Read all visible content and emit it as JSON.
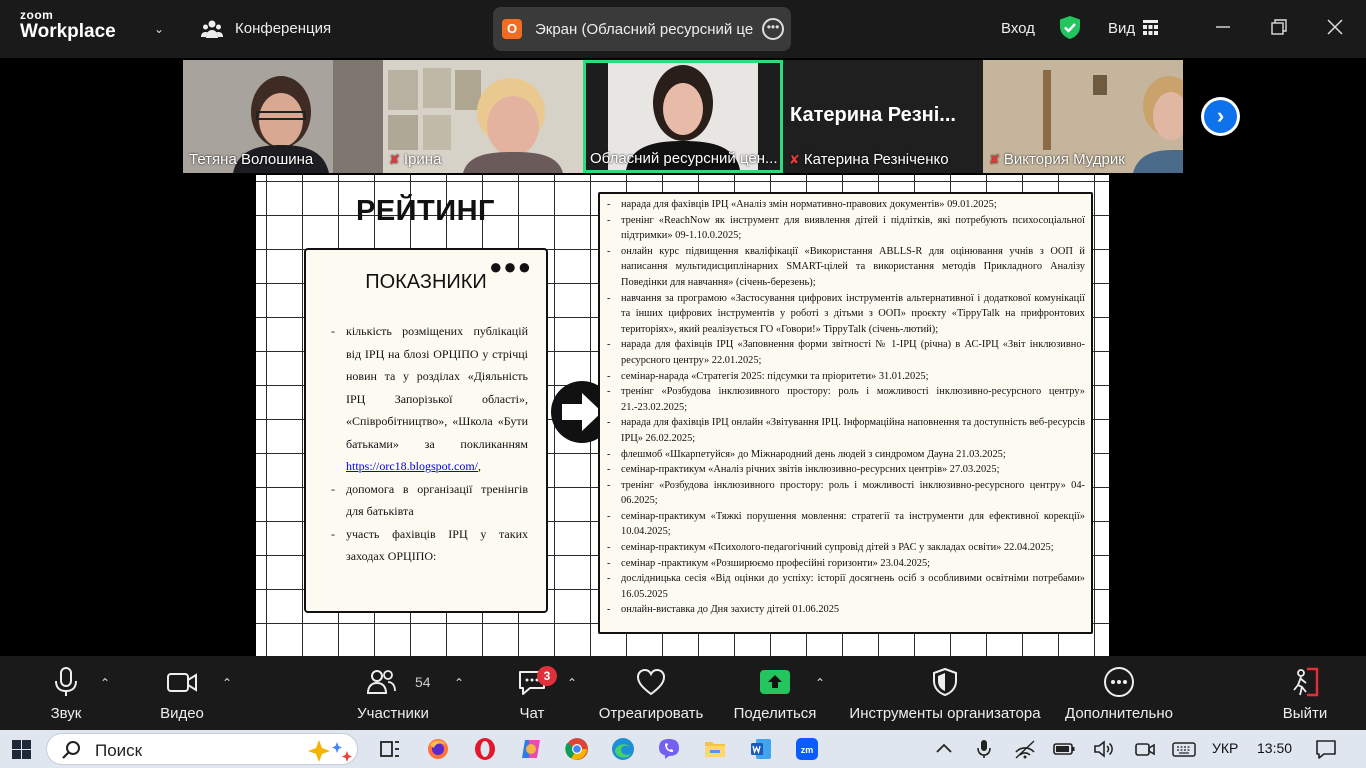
{
  "titlebar": {
    "logo_line1": "zoom",
    "logo_line2": "Workplace",
    "conference_label": "Конференция",
    "share_badge": "О",
    "share_title": "Экран (Обласний ресурсний це",
    "enter_label": "Вход",
    "view_label": "Вид"
  },
  "participants_strip": [
    {
      "name": "Тетяна Волошина",
      "muted": false
    },
    {
      "name": "Ірина",
      "muted": true
    },
    {
      "name": "Обласний ресурсний цен...",
      "muted": false,
      "active": true
    },
    {
      "name": "Катерина Резніченко",
      "muted": true,
      "big_name": "Катерина  Резні..."
    },
    {
      "name": "Виктория Мудрик",
      "muted": true
    }
  ],
  "slide": {
    "title": "РЕЙТИНГ",
    "card_title": "ПОКАЗНИКИ",
    "card_dots": "●●●",
    "indicators": [
      "кількість розміщених публікацій від ІРЦ на блозі ОРЦІПО у стрічці новин та у розділах «Діяльність ІРЦ Запорізької області», «Співробітництво», «Школа «Бути батьками» за покликанням",
      "допомога в організації тренінгів для батьківта",
      "участь фахівців ІРЦ у таких заходах ОРЦІПО:"
    ],
    "link_text": "https://orc18.blogspot.com/",
    "link_suffix": ",",
    "events": [
      "нарада для фахівців ІРЦ «Аналіз змін нормативно-правових документів» 09.01.2025;",
      "тренінг «ReachNow як інструмент для виявлення дітей і підлітків, які потребують психосоціальної підтримки» 09-1.10.0.2025;",
      "онлайн курс підвищення кваліфікації «Використання ABLLS-R для оцінювання учнів з ООП й написання мультидисциплінарних SMART-цілей та використання методів Прикладного Аналізу Поведінки для навчання» (січень-березень);",
      "навчання за програмою «Застосування цифрових інструментів альтернативної і додаткової комунікації та інших цифрових інструментів у роботі з дітьми з ООП» проєкту «TippyTalk на прифронтових територіях», який реалізується ГО «Говори!» TippyTalk (січень-лютий);",
      "нарада для фахівців ІРЦ «Заповнення форми звітності № 1-ІРЦ (річна) в АС-ІРЦ «Звіт інклюзивно-ресурсного центру» 22.01.2025;",
      "семінар-нарада «Стратегія 2025: підсумки та пріоритети» 31.01.2025;",
      "тренінг «Розбудова інклюзивного простору: роль і можливості інклюзивно-ресурсного центру» 21.-23.02.2025;",
      "нарада для фахівців ІРЦ онлайн «Звітування ІРЦ. Інформаційна наповнення та доступність веб-ресурсів ІРЦ» 26.02.2025;",
      "флешмоб «Шкарпетуйся» до Міжнародний день людей з синдромом Дауна 21.03.2025;",
      "семінар-практикум «Аналіз річних звітів інклюзивно-ресурсних центрів» 27.03.2025;",
      "тренінг «Розбудова інклюзивного простору: роль і можливості інклюзивно-ресурсного центру» 04-06.2025;",
      "семінар-практикум «Тяжкі порушення мовлення: стратегії та інструменти для ефективної корекції» 10.04.2025;",
      "семінар-практикум «Психолого-педагогічний супровід дітей з РАС у закладах освіти» 22.04.2025;",
      "семінар -практикум «Розширюємо професійні горизонти» 23.04.2025;",
      "дослідницька сесія «Від оцінки до успіху: історії досягнень осіб з особливими освітніми потребами» 16.05.2025",
      "онлайн-виставка до Дня захисту дітей 01.06.2025"
    ]
  },
  "toolbar": {
    "audio": "Звук",
    "video": "Видео",
    "participants": "Участники",
    "participants_count": "54",
    "chat": "Чат",
    "chat_badge": "3",
    "react": "Отреагировать",
    "share": "Поделиться",
    "host_tools": "Инструменты организатора",
    "more": "Дополнительно",
    "leave": "Выйти"
  },
  "taskbar": {
    "search_placeholder": "Поиск",
    "language": "УКР",
    "time": "13:50"
  },
  "colors": {
    "accent_green": "#2ddc7b",
    "zoom_blue": "#0e72ed",
    "share_green": "#22c55e",
    "mute_red": "#e23c3c",
    "leave_red": "#e0303a"
  }
}
